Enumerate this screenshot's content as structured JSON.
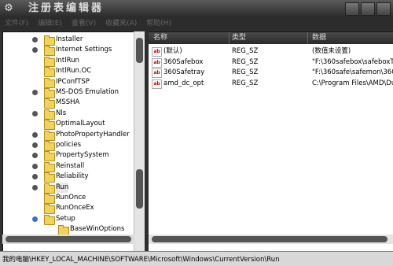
{
  "window": {
    "title": "注册表编辑器",
    "icon": "registry-editor-icon"
  },
  "menubar": {
    "items": [
      "文件(F)",
      "编辑(E)",
      "查看(V)",
      "收藏夹(A)",
      "帮助(H)"
    ]
  },
  "tree": {
    "items": [
      {
        "label": "Installer",
        "expander": true
      },
      {
        "label": "Internet Settings",
        "expander": true
      },
      {
        "label": "IntlRun",
        "expander": false
      },
      {
        "label": "IntlRun.OC",
        "expander": false
      },
      {
        "label": "IPConfTSP",
        "expander": false
      },
      {
        "label": "MS-DOS Emulation",
        "expander": true
      },
      {
        "label": "MSSHA",
        "expander": false
      },
      {
        "label": "Nls",
        "expander": true
      },
      {
        "label": "OptimalLayout",
        "expander": false
      },
      {
        "label": "PhotoPropertyHandler",
        "expander": true
      },
      {
        "label": "policies",
        "expander": true
      },
      {
        "label": "PropertySystem",
        "expander": true
      },
      {
        "label": "Reinstall",
        "expander": true
      },
      {
        "label": "Reliability",
        "expander": true
      },
      {
        "label": "Run",
        "expander": true,
        "selected": true
      },
      {
        "label": "RunOnce",
        "expander": false
      },
      {
        "label": "RunOnceEx",
        "expander": false
      },
      {
        "label": "Setup",
        "expander": true,
        "blue": true
      },
      {
        "label": "BaseWinOptions",
        "expander": false,
        "indent": true
      }
    ]
  },
  "list": {
    "columns": [
      "名称",
      "类型",
      "数据"
    ],
    "rows": [
      {
        "name": "(默认)",
        "type": "REG_SZ",
        "data": "(数值未设置)"
      },
      {
        "name": "360Safebox",
        "type": "REG_SZ",
        "data": "\"F:\\360safebox\\safeboxT"
      },
      {
        "name": "360Safetray",
        "type": "REG_SZ",
        "data": "\"F:\\360safe\\safemon\\360"
      },
      {
        "name": "amd_dc_opt",
        "type": "REG_SZ",
        "data": "C:\\Program Files\\AMD\\Du"
      }
    ]
  },
  "status": {
    "path": "我的电脑\\HKEY_LOCAL_MACHINE\\SOFTWARE\\Microsoft\\Windows\\CurrentVersion\\Run"
  }
}
